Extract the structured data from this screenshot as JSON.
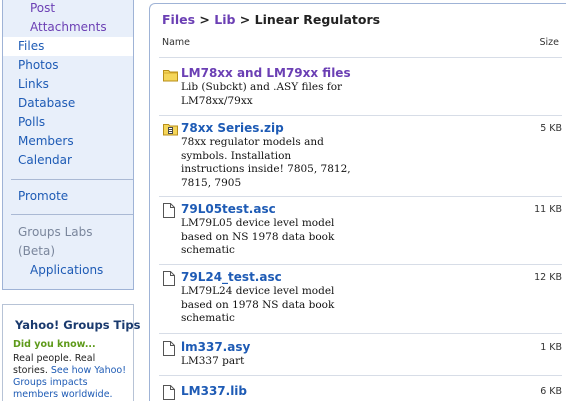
{
  "sidebar": {
    "nav": [
      {
        "label": "Post",
        "kind": "sub"
      },
      {
        "label": "Attachments",
        "kind": "sub"
      },
      {
        "label": "Files",
        "kind": "lvl1",
        "selected": true
      },
      {
        "label": "Photos",
        "kind": "lvl1"
      },
      {
        "label": "Links",
        "kind": "lvl1"
      },
      {
        "label": "Database",
        "kind": "lvl1"
      },
      {
        "label": "Polls",
        "kind": "lvl1"
      },
      {
        "label": "Members",
        "kind": "lvl1"
      },
      {
        "label": "Calendar",
        "kind": "lvl1"
      },
      {
        "label": "Promote",
        "kind": "lvl1"
      },
      {
        "label": "Groups Labs",
        "kind": "muted"
      },
      {
        "label": "(Beta)",
        "kind": "muted"
      },
      {
        "label": "Applications",
        "kind": "app"
      }
    ],
    "tips": {
      "title": "Yahoo! Groups Tips",
      "lead": "Did you know...",
      "text": "Real people. Real stories.",
      "link": "See how Yahoo! Groups impacts members worldwide."
    }
  },
  "main": {
    "breadcrumb": {
      "root": "Files",
      "middle": "Lib",
      "current": "Linear Regulators",
      "separator": ">"
    },
    "columns": {
      "name": "Name",
      "size": "Size"
    },
    "files": [
      {
        "name": "LM78xx and LM79xx files",
        "type": "folder",
        "icon": "folder-icon",
        "description": "Lib (Subckt) and .ASY files for LM78xx/79xx",
        "size": ""
      },
      {
        "name": "78xx Series.zip",
        "type": "zip",
        "icon": "zip-icon",
        "description": "78xx regulator models and symbols. Installation instructions inside! 7805, 7812, 7815, 7905",
        "size": "5 KB"
      },
      {
        "name": "79L05test.asc",
        "type": "file",
        "icon": "document-icon",
        "description": "LM79L05 device level model based on NS 1978 data book schematic",
        "size": "11 KB"
      },
      {
        "name": "79L24_test.asc",
        "type": "file",
        "icon": "document-icon",
        "description": "LM79L24 device level model based on 1978 NS data book schematic",
        "size": "12 KB"
      },
      {
        "name": "lm337.asy",
        "type": "file",
        "icon": "document-icon",
        "description": "LM337 part",
        "size": "1 KB"
      },
      {
        "name": "LM337.lib",
        "type": "file",
        "icon": "document-icon",
        "description": "",
        "size": "6 KB"
      }
    ]
  },
  "colors": {
    "link": "#1e5bb5",
    "visited": "#6b3fb4",
    "nav_bg": "#e8effa",
    "tip_green": "#5e9a1a"
  }
}
